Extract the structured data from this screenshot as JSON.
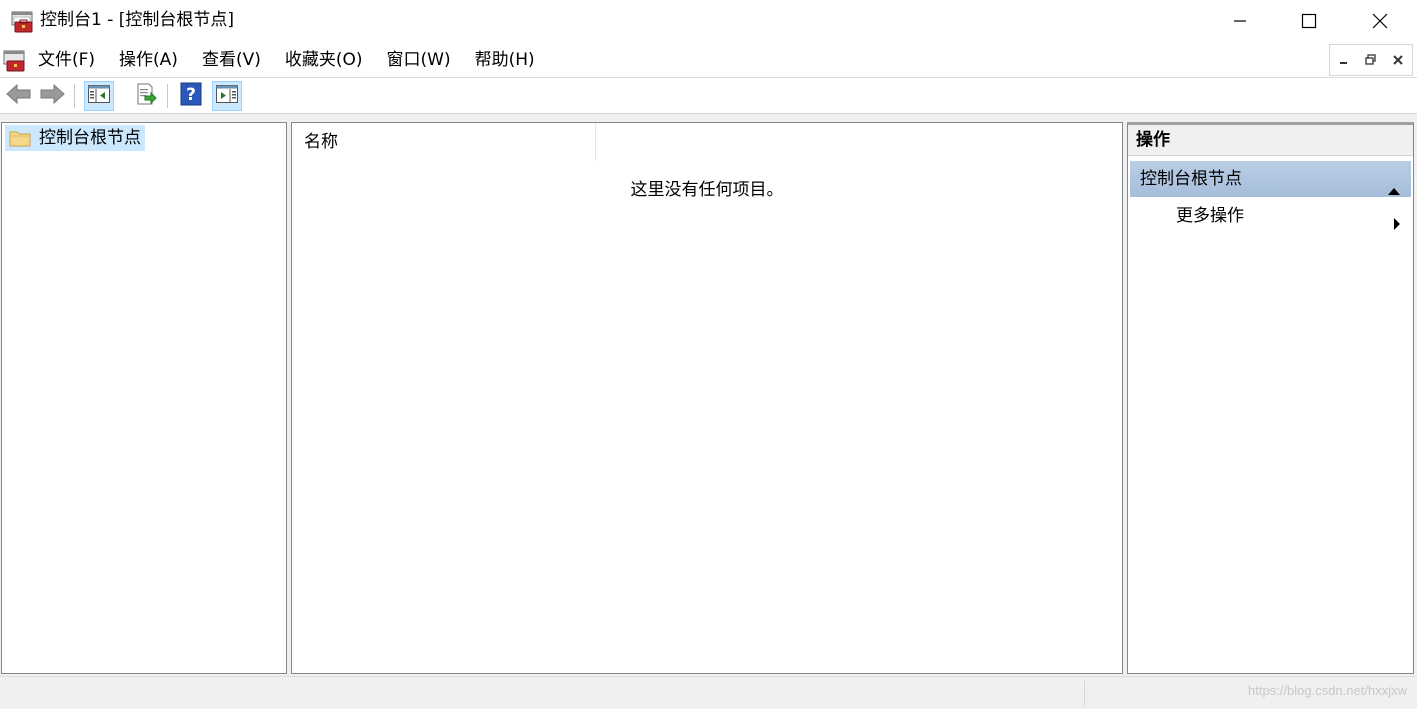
{
  "window": {
    "title": "控制台1 - [控制台根节点]"
  },
  "menu": {
    "items": [
      {
        "label": "文件(F)"
      },
      {
        "label": "操作(A)"
      },
      {
        "label": "查看(V)"
      },
      {
        "label": "收藏夹(O)"
      },
      {
        "label": "窗口(W)"
      },
      {
        "label": "帮助(H)"
      }
    ]
  },
  "toolbar": {
    "buttons": [
      "back-icon",
      "forward-icon",
      "show-hide-tree-icon",
      "export-list-icon",
      "help-icon",
      "show-hide-action-pane-icon"
    ]
  },
  "tree": {
    "root_label": "控制台根节点"
  },
  "list": {
    "column_name": "名称",
    "empty_message": "这里没有任何项目。"
  },
  "actions": {
    "header": "操作",
    "section_title": "控制台根节点",
    "more_actions": "更多操作"
  },
  "statusbar": {
    "watermark": "https://blog.csdn.net/hxxjxw"
  },
  "colors": {
    "selection": "#cce8ff",
    "section_header": "#b9cde5",
    "workarea_bg": "#f0f0f0"
  }
}
